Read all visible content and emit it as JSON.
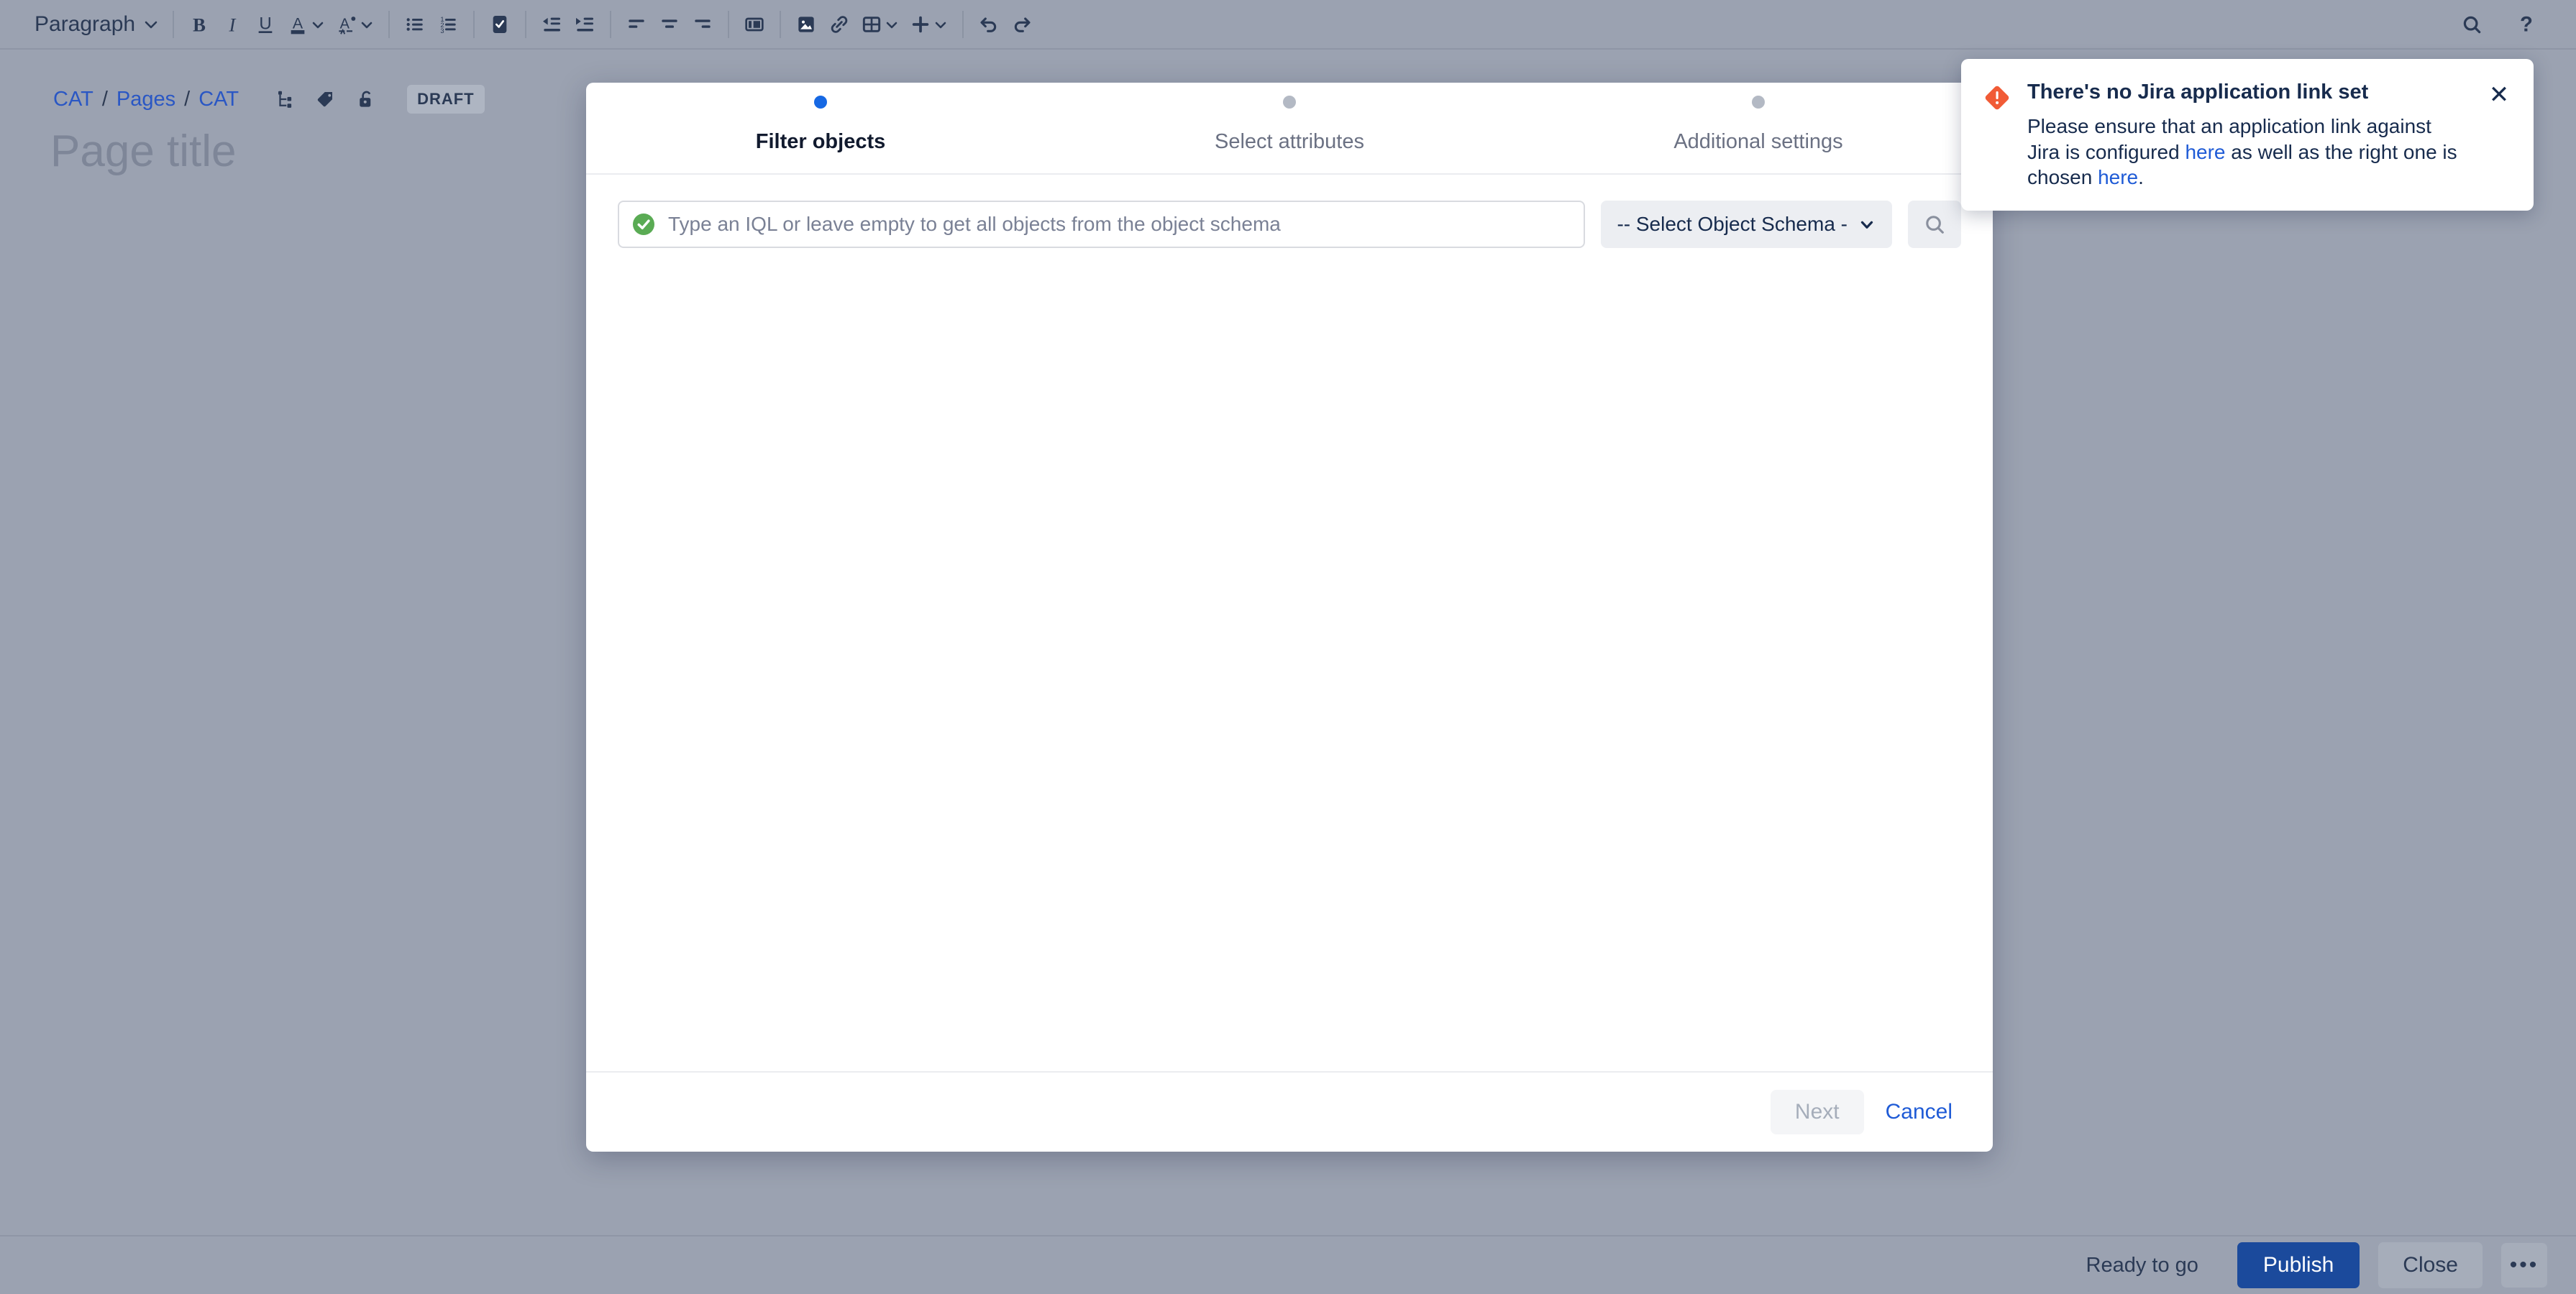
{
  "toolbar": {
    "paragraph_label": "Paragraph",
    "buttons": [
      {
        "name": "bold",
        "glyph": "B"
      },
      {
        "name": "italic",
        "glyph": "I"
      },
      {
        "name": "underline",
        "glyph": "U"
      },
      {
        "name": "text-color",
        "glyph": "A"
      },
      {
        "name": "text-style-clear",
        "glyph": "A"
      },
      {
        "name": "bullet-list",
        "glyph": ""
      },
      {
        "name": "numbered-list",
        "glyph": ""
      },
      {
        "name": "task-list",
        "glyph": ""
      },
      {
        "name": "outdent",
        "glyph": ""
      },
      {
        "name": "indent",
        "glyph": ""
      },
      {
        "name": "align-left",
        "glyph": ""
      },
      {
        "name": "align-center",
        "glyph": ""
      },
      {
        "name": "align-right",
        "glyph": ""
      },
      {
        "name": "layouts",
        "glyph": ""
      },
      {
        "name": "image",
        "glyph": ""
      },
      {
        "name": "link",
        "glyph": ""
      },
      {
        "name": "table",
        "glyph": ""
      },
      {
        "name": "insert",
        "glyph": ""
      },
      {
        "name": "undo",
        "glyph": ""
      },
      {
        "name": "redo",
        "glyph": ""
      }
    ],
    "search_icon": "search-icon",
    "help_icon": "help-icon"
  },
  "breadcrumb": {
    "items": [
      "CAT",
      "Pages",
      "CAT"
    ],
    "separator": "/",
    "status_badge": "DRAFT"
  },
  "page": {
    "title": "Page title"
  },
  "modal": {
    "steps": [
      {
        "label": "Filter objects",
        "active": true
      },
      {
        "label": "Select attributes",
        "active": false
      },
      {
        "label": "Additional settings",
        "active": false
      }
    ],
    "iql": {
      "value": "",
      "placeholder": "Type an IQL or leave empty to get all objects from the object schema",
      "validation_icon": "check-circle-icon",
      "validation_color": "#5aab54"
    },
    "schema_select": {
      "value": "-- Select Object Schema -",
      "chevron": "chevron-down-icon"
    },
    "search_button_icon": "search-icon",
    "footer": {
      "next_label": "Next",
      "cancel_label": "Cancel"
    }
  },
  "flag": {
    "icon": "error-diamond-icon",
    "icon_color": "#f15b36",
    "title": "There's no Jira application link set",
    "desc_part1": "Please ensure that an application link against Jira is configured ",
    "link1": "here",
    "desc_part2": " as well as the right one is chosen ",
    "link2": "here",
    "desc_part3": ".",
    "close_label": "✕"
  },
  "bottombar": {
    "status": "Ready to go",
    "publish_label": "Publish",
    "close_label": "Close",
    "more_label": "•••",
    "publish_color": "#1b4a9c"
  }
}
